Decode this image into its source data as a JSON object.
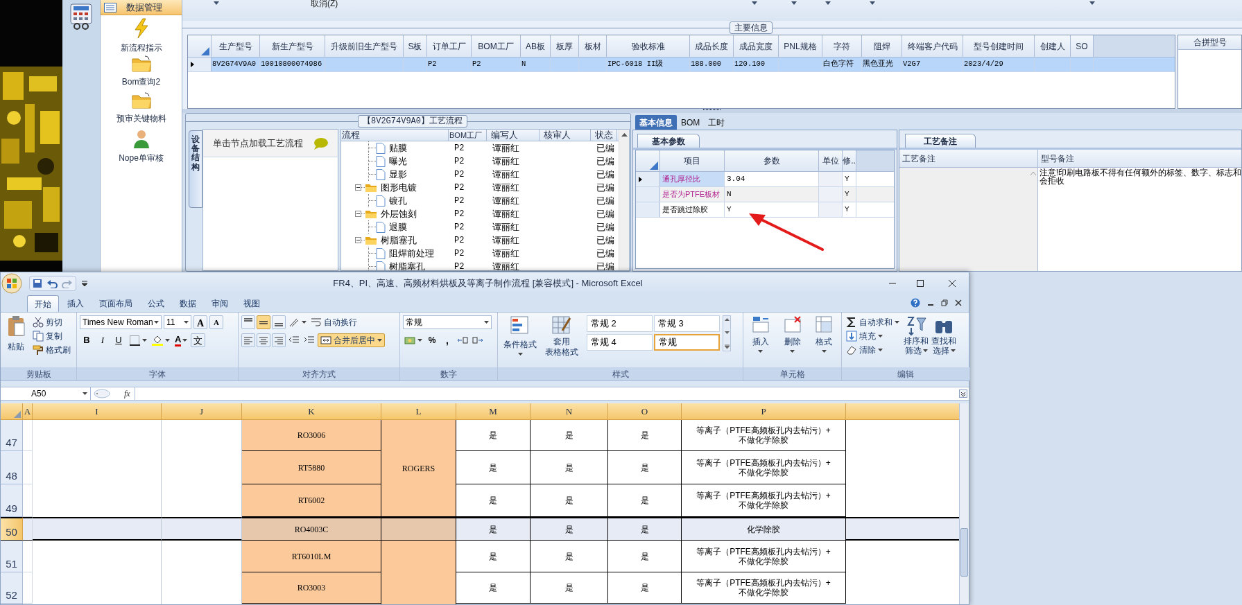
{
  "nav_panel": {
    "header": "数据管理",
    "items": [
      {
        "label": "新流程指示",
        "kind": "bolt"
      },
      {
        "label": "Bom查询2",
        "kind": "folder"
      },
      {
        "label": "预审关键物料",
        "kind": "folder"
      },
      {
        "label": "Nope单审核",
        "kind": "user"
      }
    ]
  },
  "toolbar": {
    "cancel_button": "取消(Z)"
  },
  "main_info": {
    "title": "主要信息",
    "columns": [
      "生产型号",
      "新生产型号",
      "升级前旧生产型号",
      "S板",
      "订单工厂",
      "BOM工厂",
      "AB板",
      "板厚",
      "板材",
      "验收标准",
      "成品长度",
      "成品宽度",
      "PNL规格",
      "字符",
      "阻焊",
      "终端客户代码",
      "型号创建时间",
      "创建人",
      "SO"
    ],
    "rows": [
      {
        "selected": true,
        "cells": [
          "8V2G74V9A0",
          "10010800074986",
          null,
          null,
          "P2",
          "P2",
          "N",
          null,
          null,
          "IPC-6018 II级",
          "188.000",
          "120.100",
          null,
          "白色字符",
          "黑色亚光",
          "V2G7",
          "2023/4/29",
          null,
          null
        ]
      }
    ],
    "side_heading": "合拼型号"
  },
  "process_flow": {
    "title": "【8V2G74V9A0】工艺流程",
    "side_tab": "设备结构",
    "hint": "单击节点加载工艺流程",
    "columns": [
      "流程",
      "BOM工厂",
      "编写人",
      "核审人",
      "状态"
    ],
    "tree": [
      {
        "label": "贴膜",
        "bom": "P2",
        "writer": "谭丽红",
        "status": "已编"
      },
      {
        "label": "曝光",
        "bom": "P2",
        "writer": "谭丽红",
        "status": "已编"
      },
      {
        "label": "显影",
        "bom": "P2",
        "writer": "谭丽红",
        "status": "已编"
      },
      {
        "label": "图形电镀",
        "bom": "P2",
        "writer": "谭丽红",
        "status": "已编",
        "expanded": true,
        "children": [
          {
            "label": "镀孔",
            "bom": "P2",
            "writer": "谭丽红",
            "status": "已编"
          }
        ]
      },
      {
        "label": "外层蚀刻",
        "bom": "P2",
        "writer": "谭丽红",
        "status": "已编",
        "expanded": true,
        "children": [
          {
            "label": "退膜",
            "bom": "P2",
            "writer": "谭丽红",
            "status": "已编"
          }
        ]
      },
      {
        "label": "树脂塞孔",
        "bom": "P2",
        "writer": "谭丽红",
        "status": "已编",
        "expanded": true,
        "children": [
          {
            "label": "阻焊前处理",
            "bom": "P2",
            "writer": "谭丽红",
            "status": "已编"
          },
          {
            "label": "树脂塞孔",
            "bom": "P2",
            "writer": "谭丽红",
            "status": "已编"
          }
        ]
      }
    ]
  },
  "detail_tabs": [
    {
      "label": "基本信息",
      "selected": true
    },
    {
      "label": "BOM",
      "selected": false
    },
    {
      "label": "工时",
      "selected": false
    }
  ],
  "basic_params": {
    "tab": "基本参数",
    "columns": [
      "项目",
      "参数",
      "单位",
      "修.."
    ],
    "rows": [
      {
        "item": "通孔厚径比",
        "value": "3.04",
        "flag": "Y",
        "highlighted": true,
        "selected": true
      },
      {
        "item": "是否为PTFE板材",
        "value": "N",
        "flag": "Y",
        "highlighted": true,
        "selected": false
      },
      {
        "item": "是否跳过除胶",
        "value": "Y",
        "flag": "Y",
        "highlighted": false,
        "selected": false
      }
    ]
  },
  "process_notes": {
    "tab": "工艺备注",
    "columns": [
      "工艺备注",
      "型号备注"
    ],
    "note_lines": [
      "注意!印刷电路板不得有任何额外的标签、数字、标志和",
      "会拒收"
    ]
  },
  "excel": {
    "title": "FR4、PI、高速、高频材料烘板及等离子制作流程  [兼容模式] - Microsoft Excel",
    "tabs": [
      {
        "label": "开始",
        "selected": true
      },
      {
        "label": "插入",
        "selected": false
      },
      {
        "label": "页面布局",
        "selected": false
      },
      {
        "label": "公式",
        "selected": false
      },
      {
        "label": "数据",
        "selected": false
      },
      {
        "label": "审阅",
        "selected": false
      },
      {
        "label": "视图",
        "selected": false
      }
    ],
    "clipboard": {
      "label": "剪贴板",
      "paste": "粘贴",
      "cut": "剪切",
      "copy": "复制",
      "painter": "格式刷"
    },
    "font": {
      "label": "字体",
      "name": "Times New Roman",
      "size": "11",
      "grow": "A",
      "shrink": "A",
      "bold": "B",
      "italic": "I",
      "underline": "U",
      "color_button": "A",
      "phonetic": "文"
    },
    "alignment": {
      "label": "对齐方式",
      "wrap": "自动换行",
      "merge": "合并后居中",
      "merge_on": true,
      "vertical": [
        {
          "on": false
        },
        {
          "on": true
        },
        {
          "on": false
        }
      ]
    },
    "number": {
      "label": "数字",
      "format": "常规",
      "percent": "%",
      "comma": ","
    },
    "styles": {
      "label": "样式",
      "conditional": "条件格式",
      "table_format": [
        "套用",
        "表格格式"
      ],
      "cell_styles": [
        {
          "label": "常规 2",
          "selected": false
        },
        {
          "label": "常规 3",
          "selected": false
        },
        {
          "label": "常规 4",
          "selected": false
        },
        {
          "label": "常规",
          "selected": true
        }
      ]
    },
    "cells": {
      "label": "单元格",
      "buttons": [
        "插入",
        "删除",
        "格式"
      ]
    },
    "editing": {
      "label": "编辑",
      "autosum": "自动求和",
      "fill": "填充",
      "clear": "清除",
      "sort": [
        "排序和",
        "筛选"
      ],
      "find": [
        "查找和",
        "选择"
      ]
    },
    "name_box": "A50",
    "fx": "fx",
    "sheet": {
      "columns": [
        "A",
        "I",
        "J",
        "K",
        "L",
        "M",
        "N",
        "O",
        "P"
      ],
      "rows": [
        {
          "number": "47",
          "selected": false,
          "k": "RO3006",
          "l": "ROGERS",
          "m": "是",
          "n": "是",
          "o": "是",
          "p": [
            "等离子（PTFE高频板孔内去钻污）+",
            "不做化学除胶"
          ]
        },
        {
          "number": "48",
          "selected": false,
          "k": "RT5880",
          "m": "是",
          "n": "是",
          "o": "是",
          "p": [
            "等离子（PTFE高频板孔内去钻污）+",
            "不做化学除胶"
          ]
        },
        {
          "number": "49",
          "selected": false,
          "k": "RT6002",
          "m": "是",
          "n": "是",
          "o": "是",
          "p": [
            "等离子（PTFE高频板孔内去钻污）+",
            "不做化学除胶"
          ]
        },
        {
          "number": "50",
          "selected": true,
          "k": "RO4003C",
          "m": "是",
          "n": "是",
          "o": "是",
          "p": [
            "化学除胶"
          ]
        },
        {
          "number": "51",
          "selected": false,
          "k": "RT6010LM",
          "m": "是",
          "n": "是",
          "o": "是",
          "p": [
            "等离子（PTFE高频板孔内去钻污）+",
            "不做化学除胶"
          ]
        },
        {
          "number": "52",
          "selected": false,
          "k": "RO3003",
          "m": "是",
          "n": "是",
          "o": "是",
          "p": [
            "等离子（PTFE高频板孔内去钻污）+",
            "不做化学除胶"
          ]
        }
      ]
    }
  }
}
